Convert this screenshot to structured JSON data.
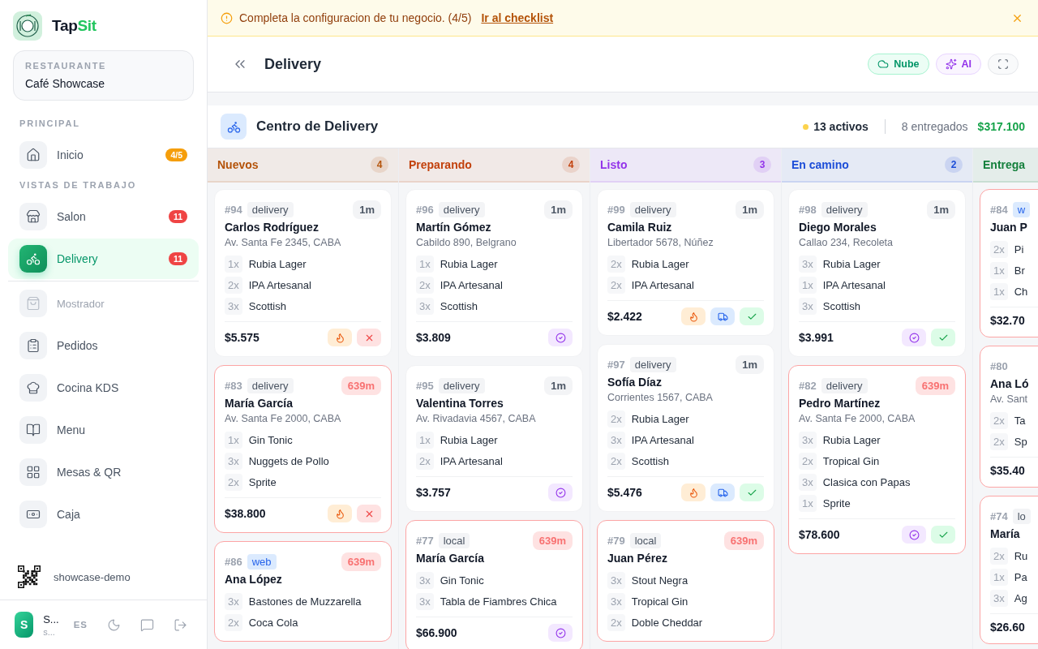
{
  "sidebar": {
    "brand": [
      "Tap",
      "Sit"
    ],
    "restaurant": {
      "label": "RESTAURANTE",
      "name": "Café Showcase"
    },
    "sections": [
      {
        "title": "PRINCIPAL",
        "items": [
          {
            "label": "Inicio",
            "selected": false,
            "disabled": false,
            "separator": false,
            "badge": {
              "text": "4/5",
              "color": "#f59e0b"
            }
          }
        ]
      },
      {
        "title": "VISTAS DE TRABAJO",
        "items": [
          {
            "label": "Salon",
            "selected": false,
            "disabled": false,
            "separator": false,
            "badge": {
              "text": "11",
              "color": "#ef4444"
            }
          },
          {
            "label": "Delivery",
            "selected": true,
            "disabled": false,
            "separator": false,
            "badge": {
              "text": "11",
              "color": "#ef4444"
            }
          },
          {
            "label": "Mostrador",
            "selected": false,
            "disabled": true,
            "separator": true
          },
          {
            "label": "Pedidos",
            "selected": false,
            "disabled": false,
            "separator": false
          },
          {
            "label": "Cocina KDS",
            "selected": false,
            "disabled": false,
            "separator": false
          },
          {
            "label": "Menu",
            "selected": false,
            "disabled": false,
            "separator": false
          },
          {
            "label": "Mesas & QR",
            "selected": false,
            "disabled": false,
            "separator": false
          },
          {
            "label": "Caja",
            "selected": false,
            "disabled": false,
            "separator": false
          }
        ]
      }
    ],
    "qr_label": "showcase-demo",
    "user": {
      "avatar": "S",
      "name": "S...",
      "sub": "s...",
      "language": "ES"
    }
  },
  "banner": {
    "message": "Completa la configuracion de tu negocio. (4/5)",
    "link": "Ir al checklist"
  },
  "header": {
    "title": "Delivery",
    "buttons": [
      {
        "label": "Nube",
        "kind": "cloud"
      },
      {
        "label": "AI",
        "kind": "ai"
      }
    ]
  },
  "center": {
    "title": "Centro de Delivery",
    "active": "13 activos",
    "delivered": "8 entregados",
    "total": "$317.100"
  },
  "columns": [
    {
      "title": "Nuevos",
      "count": "4",
      "color": "#b45309",
      "orders": [
        {
          "number": "#94",
          "channel": {
            "label": "delivery",
            "kind": "delivery"
          },
          "name": "Carlos Rodríguez",
          "address": "Av. Santa Fe 2345, CABA",
          "age": "1m",
          "late": false,
          "items": [
            {
              "qty": "1x",
              "name": "Rubia Lager"
            },
            {
              "qty": "2x",
              "name": "IPA Artesanal"
            },
            {
              "qty": "3x",
              "name": "Scottish"
            }
          ],
          "total": "$5.575",
          "actions": [
            {
              "kind": "fire"
            },
            {
              "kind": "cancel"
            }
          ]
        },
        {
          "number": "#83",
          "channel": {
            "label": "delivery",
            "kind": "delivery"
          },
          "name": "María García",
          "address": "Av. Santa Fe 2000, CABA",
          "age": "639m",
          "late": true,
          "items": [
            {
              "qty": "1x",
              "name": "Gin Tonic"
            },
            {
              "qty": "3x",
              "name": "Nuggets de Pollo"
            },
            {
              "qty": "2x",
              "name": "Sprite"
            }
          ],
          "total": "$38.800",
          "actions": [
            {
              "kind": "fire"
            },
            {
              "kind": "cancel"
            }
          ]
        },
        {
          "number": "#86",
          "channel": {
            "label": "web",
            "kind": "web"
          },
          "name": "Ana López",
          "age": "639m",
          "late": true,
          "items": [
            {
              "qty": "3x",
              "name": "Bastones de Muzzarella"
            },
            {
              "qty": "2x",
              "name": "Coca Cola"
            }
          ]
        }
      ]
    },
    {
      "title": "Preparando",
      "count": "4",
      "color": "#c2410c",
      "orders": [
        {
          "number": "#96",
          "channel": {
            "label": "delivery",
            "kind": "delivery"
          },
          "name": "Martín Gómez",
          "address": "Cabildo 890, Belgrano",
          "age": "1m",
          "late": false,
          "items": [
            {
              "qty": "1x",
              "name": "Rubia Lager"
            },
            {
              "qty": "2x",
              "name": "IPA Artesanal"
            },
            {
              "qty": "3x",
              "name": "Scottish"
            }
          ],
          "total": "$3.809",
          "actions": [
            {
              "kind": "ready"
            }
          ]
        },
        {
          "number": "#95",
          "channel": {
            "label": "delivery",
            "kind": "delivery"
          },
          "name": "Valentina Torres",
          "address": "Av. Rivadavia 4567, CABA",
          "age": "1m",
          "late": false,
          "items": [
            {
              "qty": "1x",
              "name": "Rubia Lager"
            },
            {
              "qty": "2x",
              "name": "IPA Artesanal"
            }
          ],
          "total": "$3.757",
          "actions": [
            {
              "kind": "ready"
            }
          ]
        },
        {
          "number": "#77",
          "channel": {
            "label": "local",
            "kind": "local"
          },
          "name": "María García",
          "age": "639m",
          "late": true,
          "items": [
            {
              "qty": "3x",
              "name": "Gin Tonic"
            },
            {
              "qty": "3x",
              "name": "Tabla de Fiambres Chica"
            }
          ],
          "total": "$66.900",
          "actions": [
            {
              "kind": "ready"
            }
          ]
        }
      ]
    },
    {
      "title": "Listo",
      "count": "3",
      "color": "#9333ea",
      "orders": [
        {
          "number": "#99",
          "channel": {
            "label": "delivery",
            "kind": "delivery"
          },
          "name": "Camila Ruiz",
          "address": "Libertador 5678, Núñez",
          "age": "1m",
          "late": false,
          "items": [
            {
              "qty": "2x",
              "name": "Rubia Lager"
            },
            {
              "qty": "2x",
              "name": "IPA Artesanal"
            }
          ],
          "total": "$2.422",
          "actions": [
            {
              "kind": "fire"
            },
            {
              "kind": "dispatch"
            },
            {
              "kind": "deliver"
            }
          ]
        },
        {
          "number": "#97",
          "channel": {
            "label": "delivery",
            "kind": "delivery"
          },
          "name": "Sofía Díaz",
          "address": "Corrientes 1567, CABA",
          "age": "1m",
          "late": false,
          "items": [
            {
              "qty": "2x",
              "name": "Rubia Lager"
            },
            {
              "qty": "3x",
              "name": "IPA Artesanal"
            },
            {
              "qty": "2x",
              "name": "Scottish"
            }
          ],
          "total": "$5.476",
          "actions": [
            {
              "kind": "fire"
            },
            {
              "kind": "dispatch"
            },
            {
              "kind": "deliver"
            }
          ]
        },
        {
          "number": "#79",
          "channel": {
            "label": "local",
            "kind": "local"
          },
          "name": "Juan Pérez",
          "age": "639m",
          "late": true,
          "items": [
            {
              "qty": "3x",
              "name": "Stout Negra"
            },
            {
              "qty": "3x",
              "name": "Tropical Gin"
            },
            {
              "qty": "2x",
              "name": "Doble Cheddar"
            }
          ]
        }
      ]
    },
    {
      "title": "En camino",
      "count": "2",
      "color": "#1d4ed8",
      "orders": [
        {
          "number": "#98",
          "channel": {
            "label": "delivery",
            "kind": "delivery"
          },
          "name": "Diego Morales",
          "address": "Callao 234, Recoleta",
          "age": "1m",
          "late": false,
          "items": [
            {
              "qty": "3x",
              "name": "Rubia Lager"
            },
            {
              "qty": "1x",
              "name": "IPA Artesanal"
            },
            {
              "qty": "3x",
              "name": "Scottish"
            }
          ],
          "total": "$3.991",
          "actions": [
            {
              "kind": "ready"
            },
            {
              "kind": "deliver"
            }
          ]
        },
        {
          "number": "#82",
          "channel": {
            "label": "delivery",
            "kind": "delivery"
          },
          "name": "Pedro Martínez",
          "address": "Av. Santa Fe 2000, CABA",
          "age": "639m",
          "late": true,
          "items": [
            {
              "qty": "3x",
              "name": "Rubia Lager"
            },
            {
              "qty": "2x",
              "name": "Tropical Gin"
            },
            {
              "qty": "3x",
              "name": "Clasica con Papas"
            },
            {
              "qty": "1x",
              "name": "Sprite"
            }
          ],
          "total": "$78.600",
          "actions": [
            {
              "kind": "ready"
            },
            {
              "kind": "deliver"
            }
          ]
        }
      ]
    },
    {
      "title": "Entrega",
      "color": "#15803d",
      "orders": [
        {
          "number": "#84",
          "channel": {
            "label": "w",
            "kind": "web"
          },
          "name": "Juan P",
          "late": true,
          "items": [
            {
              "qty": "2x",
              "name": "Pi"
            },
            {
              "qty": "1x",
              "name": "Br"
            },
            {
              "qty": "1x",
              "name": "Ch"
            }
          ],
          "total": "$32.70"
        },
        {
          "number": "#80",
          "name": "Ana Ló",
          "address": "Av. Sant",
          "late": true,
          "items": [
            {
              "qty": "2x",
              "name": "Ta"
            },
            {
              "qty": "2x",
              "name": "Sp"
            }
          ],
          "total": "$35.40"
        },
        {
          "number": "#74",
          "channel": {
            "label": "lo",
            "kind": "local"
          },
          "name": "María",
          "late": true,
          "items": [
            {
              "qty": "2x",
              "name": "Ru"
            },
            {
              "qty": "1x",
              "name": "Pa"
            },
            {
              "qty": "3x",
              "name": "Ag"
            }
          ],
          "total": "$26.60"
        }
      ]
    }
  ]
}
